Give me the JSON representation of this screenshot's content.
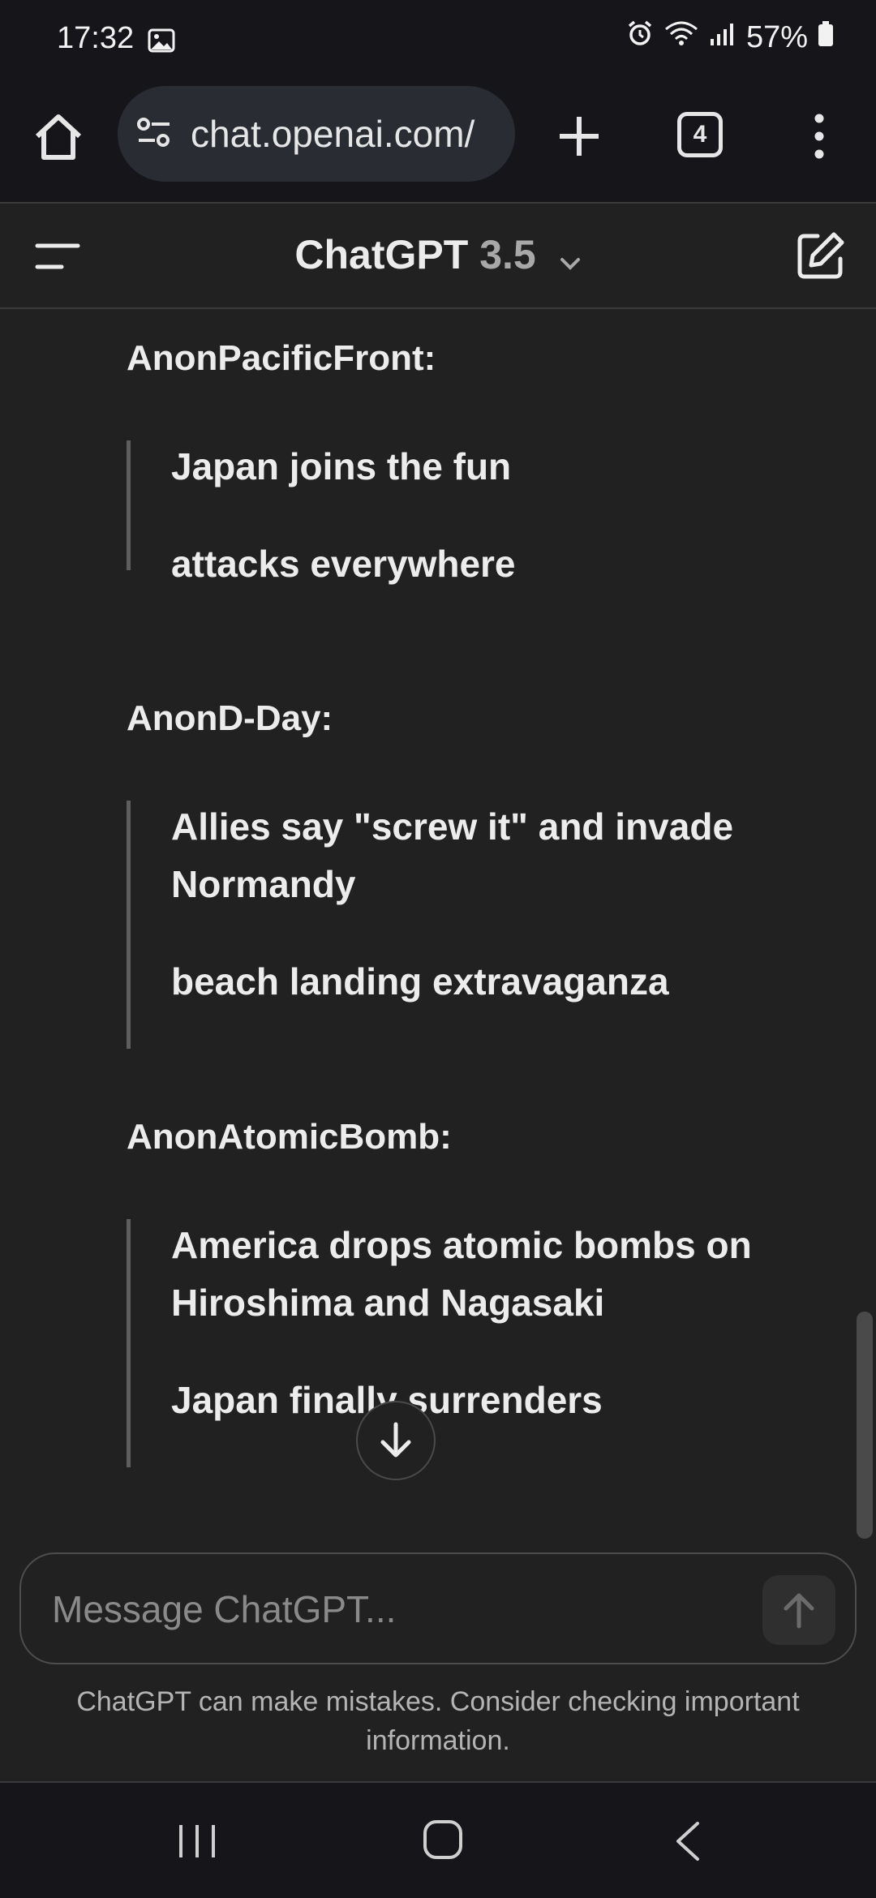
{
  "status_bar": {
    "time": "17:32",
    "battery": "57%"
  },
  "browser": {
    "url": "chat.openai.com/",
    "tab_count": "4"
  },
  "header": {
    "title": "ChatGPT",
    "version": "3.5"
  },
  "messages": [
    {
      "heading": "AnonPacificFront:",
      "lines": [
        "Japan joins the fun",
        "attacks everywhere"
      ]
    },
    {
      "heading": "AnonD-Day:",
      "lines": [
        "Allies say \"screw it\" and invade Normandy",
        "beach landing extravaganza"
      ]
    },
    {
      "heading": "AnonAtomicBomb:",
      "lines": [
        "America drops atomic bombs on Hiroshima and Nagasaki",
        "Japan finally surrenders"
      ]
    }
  ],
  "composer": {
    "placeholder": "Message ChatGPT..."
  },
  "disclaimer": "ChatGPT can make mistakes. Consider checking important information.",
  "icons": [
    "image-icon",
    "alarm-icon",
    "wifi-icon",
    "signal-icon",
    "battery-icon",
    "home-icon",
    "site-settings-icon",
    "plus-icon",
    "more-icon",
    "sidebar-menu-icon",
    "chevron-down-icon",
    "compose-icon",
    "arrow-down-icon",
    "arrow-up-icon",
    "recents-icon",
    "home-nav-icon",
    "back-icon"
  ]
}
